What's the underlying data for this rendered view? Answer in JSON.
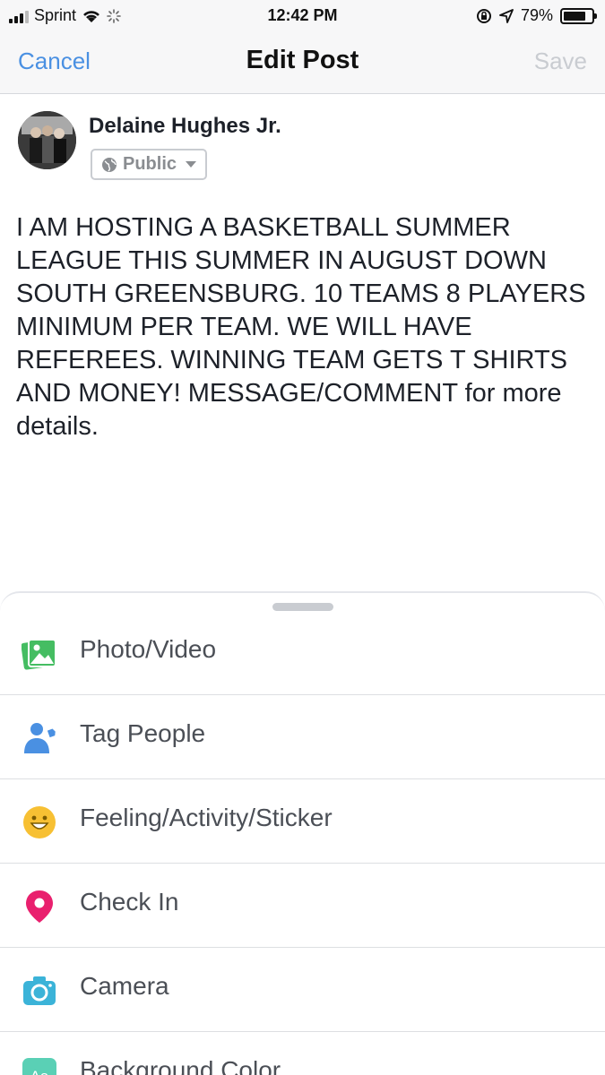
{
  "status_bar": {
    "carrier": "Sprint",
    "time": "12:42 PM",
    "battery_percent": "79%",
    "battery_level": 0.79
  },
  "nav": {
    "cancel": "Cancel",
    "title": "Edit Post",
    "save": "Save"
  },
  "author": {
    "name": "Delaine Hughes Jr.",
    "privacy": "Public"
  },
  "post_text": "I AM HOSTING A BASKETBALL SUMMER\nLEAGUE THIS SUMMER IN AUGUST DOWN\nSOUTH GREENSBURG. 10 TEAMS 8 PLAYERS\nMINIMUM PER TEAM. WE WILL HAVE\nREFEREES. WINNING TEAM GETS T SHIRTS\nAND MONEY! MESSAGE/COMMENT for more\ndetails.",
  "composer_options": [
    {
      "label": "Photo/Video",
      "icon": "photo-icon",
      "color": "#45bd62"
    },
    {
      "label": "Tag People",
      "icon": "tag-people-icon",
      "color": "#4a90e2"
    },
    {
      "label": "Feeling/Activity/Sticker",
      "icon": "feeling-icon",
      "color": "#f7c033"
    },
    {
      "label": "Check In",
      "icon": "location-pin-icon",
      "color": "#e9206e"
    },
    {
      "label": "Camera",
      "icon": "camera-icon",
      "color": "#3bb3d8"
    },
    {
      "label": "Background Color",
      "icon": "background-color-icon",
      "color": "#5ad0b5"
    }
  ]
}
